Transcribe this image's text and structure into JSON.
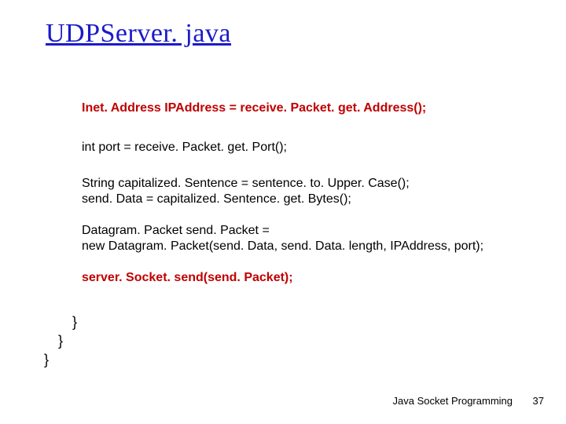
{
  "title": "UDPServer. java",
  "code": {
    "line1": "Inet. Address IPAddress = receive. Packet. get. Address();",
    "line2": "int port = receive. Packet. get. Port();",
    "line3a": "String capitalized. Sentence = sentence. to. Upper. Case();",
    "line3b": " send. Data = capitalized. Sentence. get. Bytes();",
    "line4a": "Datagram. Packet send. Packet =",
    "line4b": "      new Datagram. Packet(send. Data, send. Data. length, IPAddress, port);",
    "line5": " server. Socket. send(send. Packet);",
    "brace1": "}",
    "brace2": "}",
    "brace3": "}"
  },
  "footer": {
    "text": "Java Socket Programming",
    "page": "37"
  }
}
